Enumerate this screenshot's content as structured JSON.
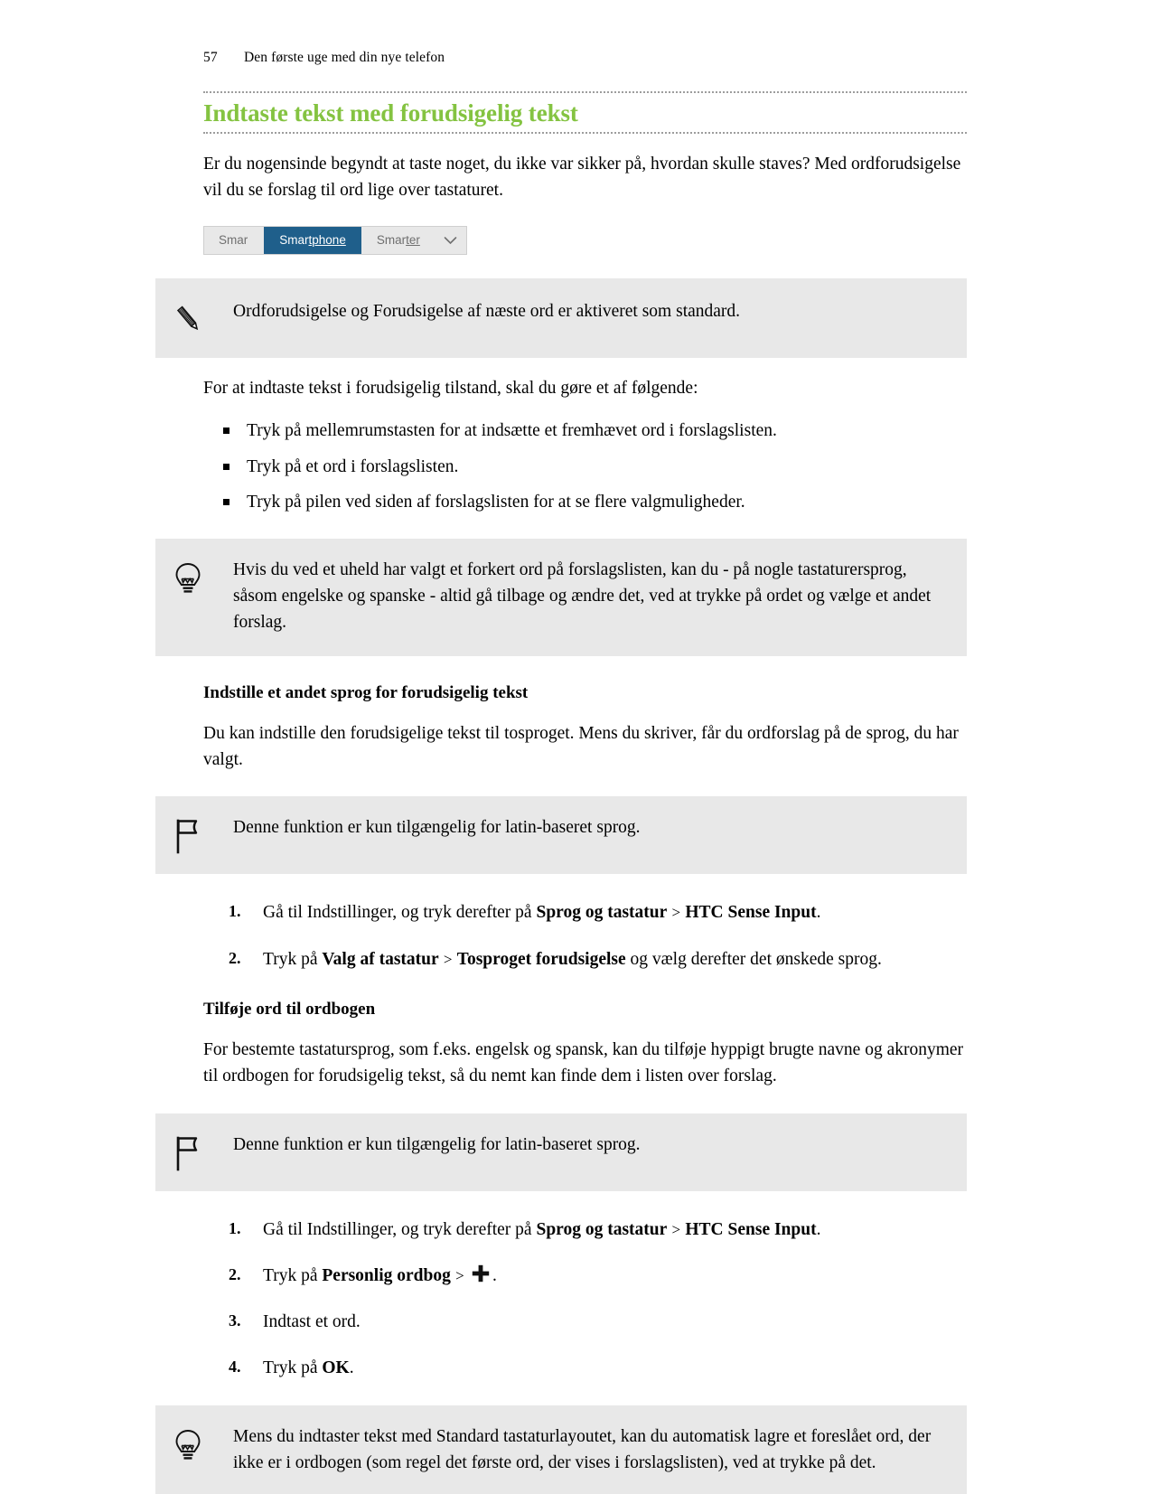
{
  "header": {
    "page_number": "57",
    "breadcrumb": "Den første uge med din nye telefon"
  },
  "section": {
    "title": "Indtaste tekst med forudsigelig tekst",
    "title_color": "#84c341"
  },
  "intro": {
    "paragraph": "Er du nogensinde begyndt at taste noget, du ikke var sikker på, hvordan skulle staves? Med ordforudsigelse vil du se forslag til ord lige over tastaturet."
  },
  "suggestion_bar": {
    "items": [
      {
        "label": "Smar",
        "state": "normal",
        "underline": ""
      },
      {
        "label": "Smartphone",
        "state": "selected",
        "underline": "tphone",
        "prefix": "Smar"
      },
      {
        "label": "Smarter",
        "state": "normal",
        "underline": "ter",
        "prefix": "Smar"
      }
    ],
    "expand_icon": "chevron-down-icon",
    "selected_bg": "#1f5f8b",
    "bar_bg": "#e8e8e8"
  },
  "note_box": {
    "icon": "pen-icon",
    "text": "Ordforudsigelse og Forudsigelse af næste ord er aktiveret som standard."
  },
  "howto": {
    "lead": "For at indtaste tekst i forudsigelig tilstand, skal du gøre et af følgende:",
    "bullets": [
      "Tryk på mellemrumstasten for at indsætte et fremhævet ord i forslagslisten.",
      "Tryk på et ord i forslagslisten.",
      "Tryk på pilen ved siden af forslagslisten for at se flere valgmuligheder."
    ]
  },
  "tip_box_1": {
    "icon": "lightbulb-icon",
    "text": "Hvis du ved et uheld har valgt et forkert ord på forslagslisten, kan du - på nogle tastaturersprog, såsom engelske og spanske - altid gå tilbage og ændre det, ved at trykke på ordet og vælge et andet forslag."
  },
  "language_section": {
    "heading": "Indstille et andet sprog for forudsigelig tekst",
    "paragraph": "Du kan indstille den forudsigelige tekst til tosproget. Mens du skriver, får du ordforslag på de sprog, du har valgt.",
    "flag_box": {
      "icon": "flag-icon",
      "text": "Denne funktion er kun tilgængelig for latin-baseret sprog."
    },
    "steps": [
      {
        "prefix": "Gå til Indstillinger, og tryk derefter på ",
        "bold1": "Sprog og tastatur",
        "sep": " > ",
        "bold2": "HTC Sense Input",
        "suffix": "."
      },
      {
        "prefix": "Tryk på ",
        "bold1": "Valg af tastatur",
        "sep": " > ",
        "bold2": "Tosproget forudsigelse",
        "suffix": " og vælg derefter det ønskede sprog."
      }
    ]
  },
  "dictionary_section": {
    "heading": "Tilføje ord til ordbogen",
    "paragraph": "For bestemte tastatursprog, som f.eks. engelsk og spansk, kan du tilføje hyppigt brugte navne og akronymer til ordbogen for forudsigelig tekst, så du nemt kan finde dem i listen over forslag.",
    "flag_box": {
      "icon": "flag-icon",
      "text": "Denne funktion er kun tilgængelig for latin-baseret sprog."
    },
    "steps": [
      {
        "prefix": "Gå til Indstillinger, og tryk derefter på ",
        "bold1": "Sprog og tastatur",
        "sep": " > ",
        "bold2": "HTC Sense Input",
        "suffix": "."
      },
      {
        "prefix": "Tryk på ",
        "bold1": "Personlig ordbog",
        "sep": " > ",
        "icon": "plus-icon",
        "suffix": "."
      },
      {
        "plain": "Indtast et ord."
      },
      {
        "prefix": "Tryk på ",
        "bold1": "OK",
        "suffix": "."
      }
    ]
  },
  "tip_box_2": {
    "icon": "lightbulb-icon",
    "text": "Mens du indtaster tekst med Standard tastaturlayoutet, kan du automatisk lagre et foreslået ord, der ikke er i ordbogen (som regel det første ord, der vises i forslagslisten), ved at trykke på det."
  }
}
